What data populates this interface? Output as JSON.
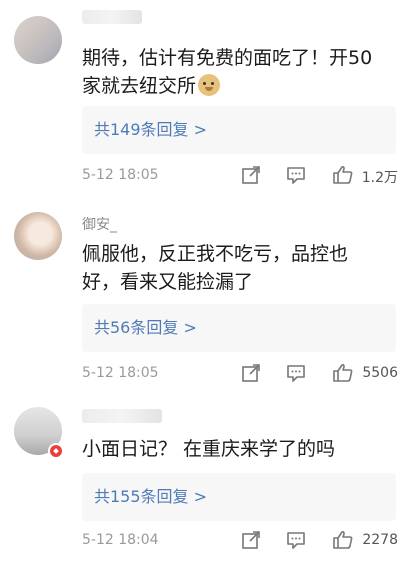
{
  "comments": [
    {
      "text": "期待，估计有免费的面吃了！开50家就去纽交所",
      "emoji": "doge",
      "reply_label": "共149条回复 >",
      "time": "5-12 18:05",
      "likes": "1.2万"
    },
    {
      "nickname": "御安_",
      "text": "佩服他，反正我不吃亏，品控也好，看来又能捡漏了",
      "reply_label": "共56条回复 >",
      "time": "5-12 18:05",
      "likes": "5506"
    },
    {
      "text": "小面日记？ 在重庆来学了的吗",
      "reply_label": "共155条回复 >",
      "time": "5-12 18:04",
      "likes": "2278"
    }
  ],
  "icons": [
    "forward-icon",
    "comment-icon",
    "like-icon"
  ],
  "colors": {
    "link": "#4e7bb7",
    "meta": "#9a9a9a",
    "reply_bg": "#f7f7f7",
    "badge": "#e8413b"
  }
}
